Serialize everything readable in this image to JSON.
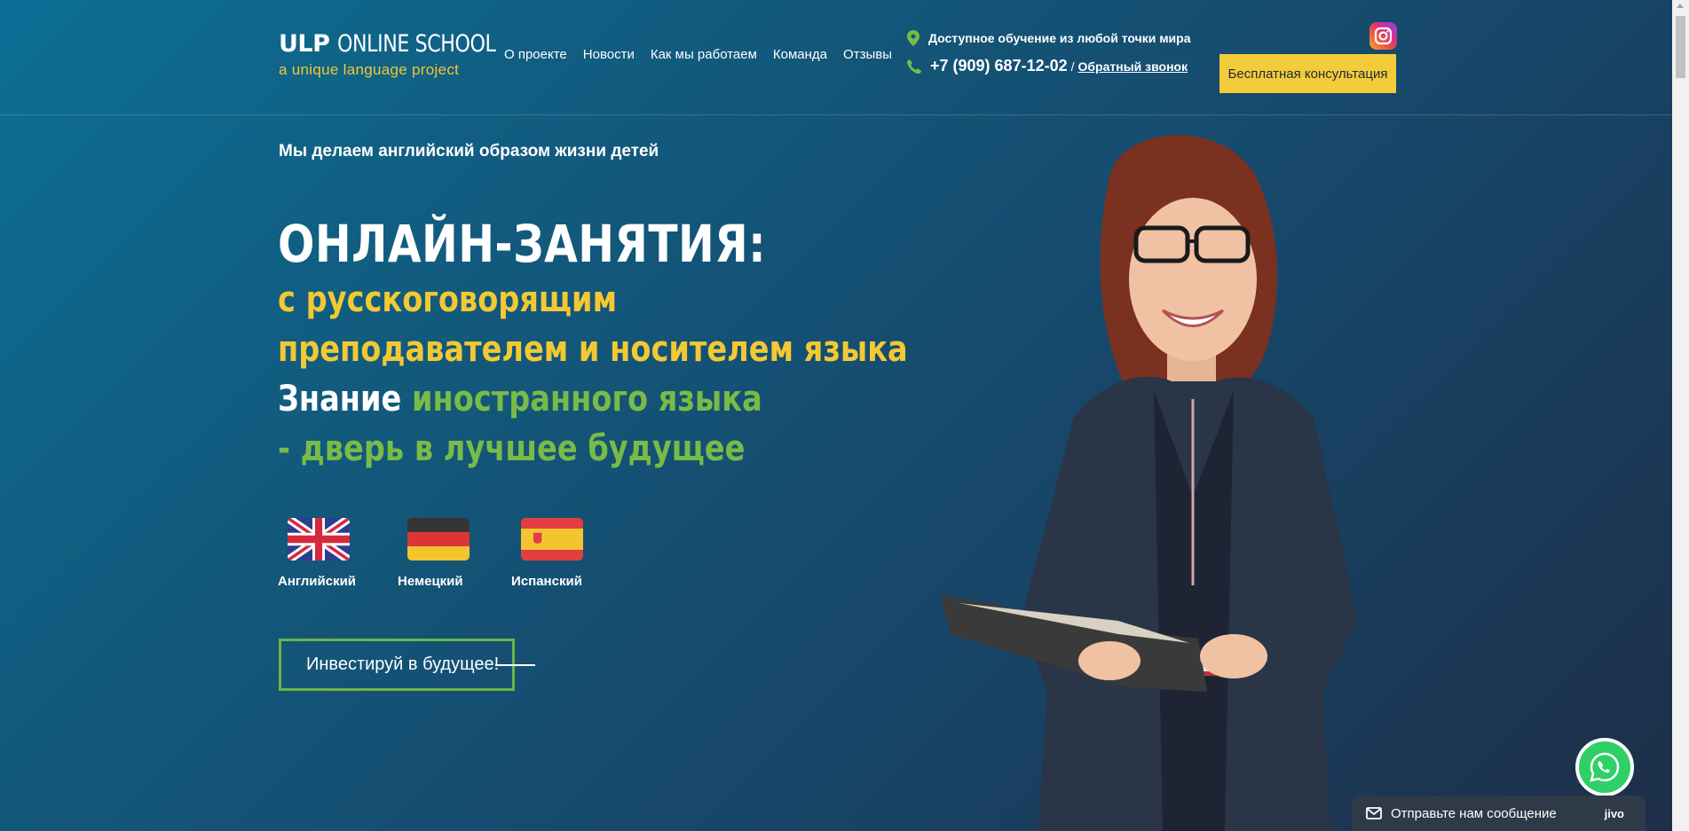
{
  "header": {
    "logo": {
      "brand": "ULP",
      "brand_rest": "ONLINE SCHOOL",
      "subtitle": "a unique language project"
    },
    "nav": [
      {
        "label": "О проекте"
      },
      {
        "label": "Новости"
      },
      {
        "label": "Как мы работаем"
      },
      {
        "label": "Команда"
      },
      {
        "label": "Отзывы"
      }
    ],
    "location_text": "Доступное обучение из любой точки мира",
    "phone": "+7 (909) 687-12-02",
    "phone_separator": "/",
    "callback_label": "Обратный звонок",
    "consult_button": "Бесплатная консультация",
    "social_icon": "instagram-icon"
  },
  "hero": {
    "tagline": "Мы делаем английский образом жизни детей",
    "title_line1": "ОНЛАЙН-ЗАНЯТИЯ:",
    "title_line2": "с русскоговорящим",
    "title_line3": "преподавателем и носителем языка",
    "title_line4_white": "Знание ",
    "title_line4_green": "иностранного языка",
    "title_line5": "- дверь в лучшее будущее",
    "languages": [
      {
        "label": "Английский",
        "flag": "uk-flag-icon"
      },
      {
        "label": "Немецкий",
        "flag": "germany-flag-icon"
      },
      {
        "label": "Испанский",
        "flag": "spain-flag-icon"
      }
    ],
    "cta_button": "Инвестируй в будущее!"
  },
  "widgets": {
    "chat_text": "Отправьте нам сообщение",
    "chat_brand": "jivo"
  },
  "colors": {
    "accent_yellow": "#f2c933",
    "accent_green": "#79bb47",
    "button_yellow": "#f4cb38",
    "whatsapp_green": "#2fd067"
  }
}
